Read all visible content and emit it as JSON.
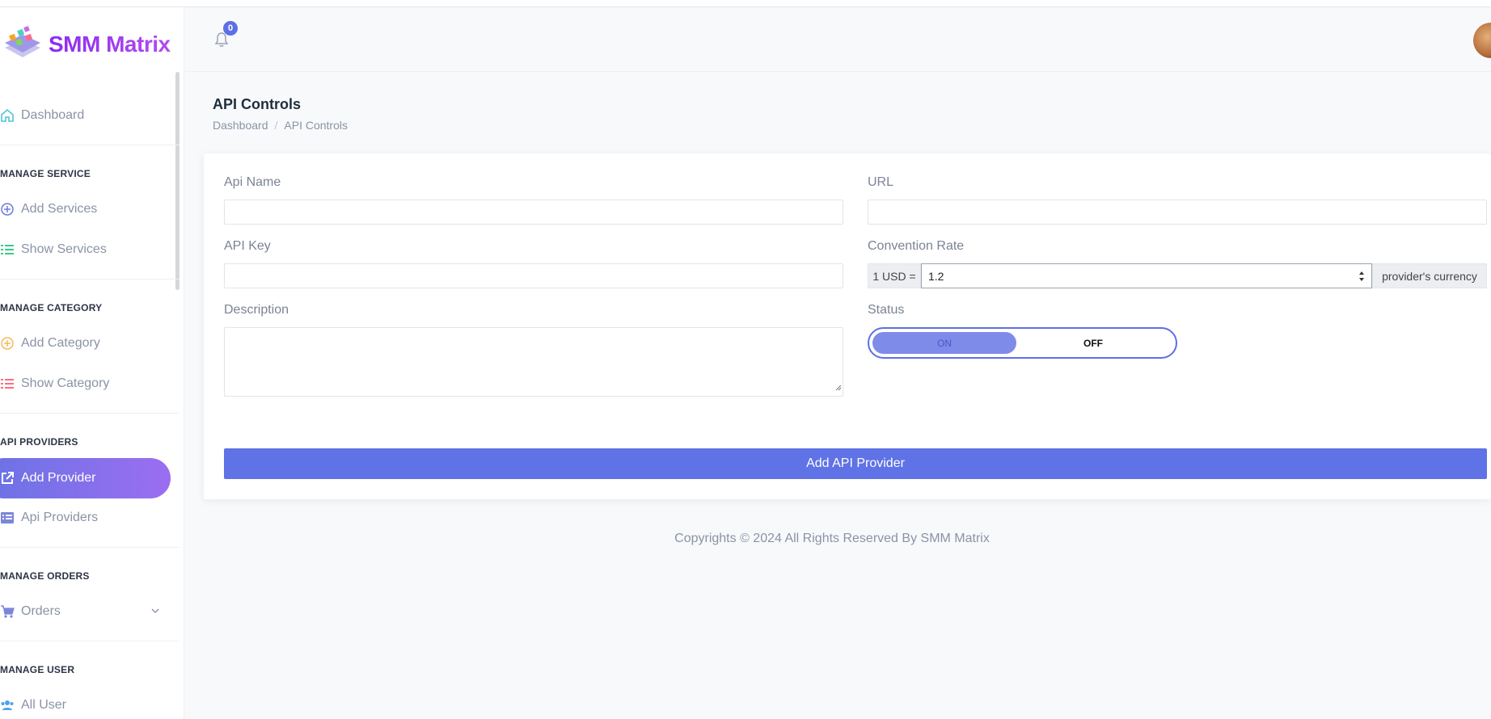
{
  "brand": {
    "name": "SMM Matrix"
  },
  "header": {
    "notification_count": "0"
  },
  "sidebar": {
    "dashboard": "Dashboard",
    "sections": [
      {
        "heading": "MANAGE SERVICE",
        "items": [
          "Add Services",
          "Show Services"
        ]
      },
      {
        "heading": "MANAGE CATEGORY",
        "items": [
          "Add Category",
          "Show Category"
        ]
      },
      {
        "heading": "API PROVIDERS",
        "items": [
          "Add Provider",
          "Api Providers"
        ]
      },
      {
        "heading": "MANAGE ORDERS",
        "items": [
          "Orders"
        ]
      },
      {
        "heading": "MANAGE USER",
        "items": [
          "All User"
        ]
      }
    ]
  },
  "page": {
    "title": "API Controls",
    "breadcrumb": [
      "Dashboard",
      "API Controls"
    ]
  },
  "form": {
    "api_name_label": "Api Name",
    "url_label": "URL",
    "api_key_label": "API Key",
    "rate_label": "Convention Rate",
    "rate_prefix": "1 USD =",
    "rate_value": "1.2",
    "rate_suffix": "provider's currency",
    "description_label": "Description",
    "status_label": "Status",
    "status_on": "ON",
    "status_off": "OFF",
    "submit_label": "Add API Provider"
  },
  "footer": {
    "text": "Copyrights © 2024 All Rights Reserved By SMM Matrix"
  },
  "colors": {
    "accent": "#5f72e6",
    "brand_purple": "#8b2cf0"
  }
}
